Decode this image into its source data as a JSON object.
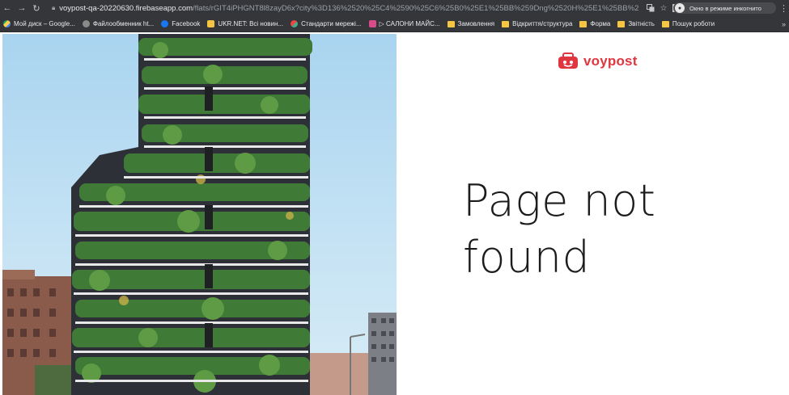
{
  "browser": {
    "url_host": "voypost-qa-20220630.firebaseapp.com",
    "url_path": "/flats/rGIT4iPHGNT8l8zayD6x?city%3D136%2520%25C4%2590%25C6%25B0%25E1%25BB%259Dng%2520H%25E1%25BB%2593...",
    "incognito_label": "Окно в режиме инкогнито"
  },
  "bookmarks": [
    {
      "label": "Мой диск – Google...",
      "icon": "drive"
    },
    {
      "label": "Файлообменник ht...",
      "icon": "cloud"
    },
    {
      "label": "Facebook",
      "icon": "fb"
    },
    {
      "label": "UKR.NET: Всі новин...",
      "icon": "ukr"
    },
    {
      "label": "Стандарти мережі...",
      "icon": "std"
    },
    {
      "label": "▷ САЛОНИ МАЙС...",
      "icon": "db"
    },
    {
      "label": "Замовлення",
      "icon": "folder"
    },
    {
      "label": "Відкриття/структура",
      "icon": "folder"
    },
    {
      "label": "Форма",
      "icon": "folder"
    },
    {
      "label": "Звітність",
      "icon": "folder"
    },
    {
      "label": "Пошук роботи",
      "icon": "folder"
    }
  ],
  "page": {
    "logo_text": "voypost",
    "title_line1": "Page not",
    "title_line2": "found"
  },
  "colors": {
    "brand": "#e0363f",
    "chrome": "#35363a"
  }
}
